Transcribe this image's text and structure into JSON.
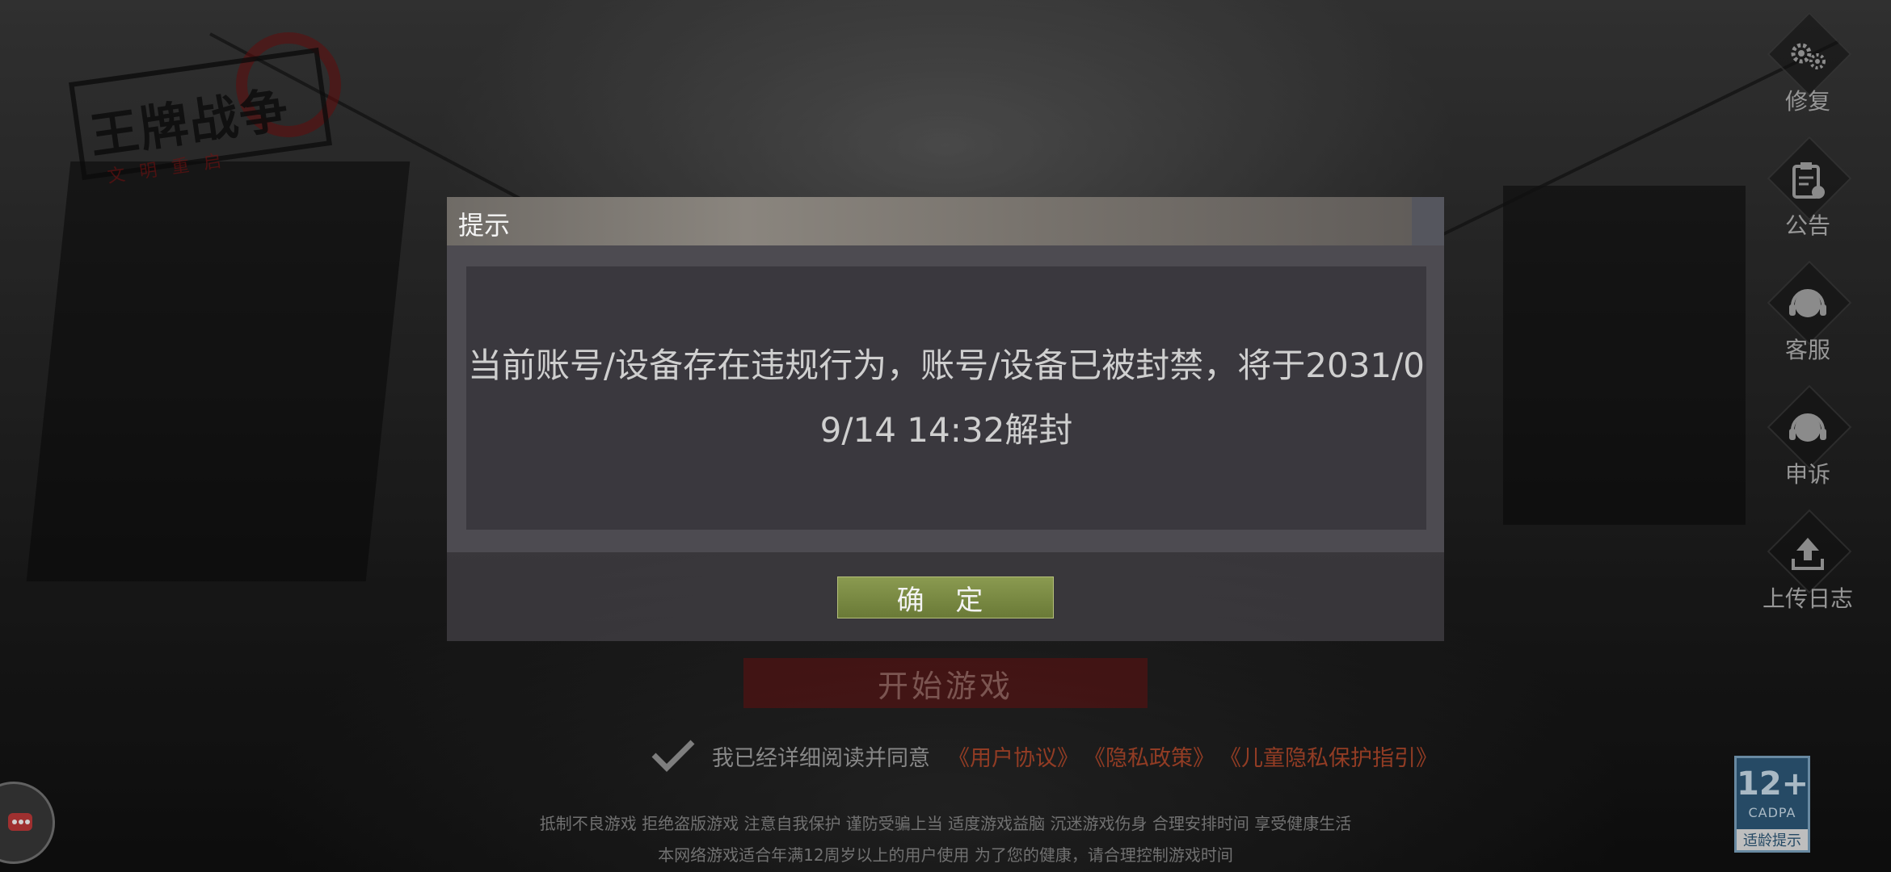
{
  "logo": {
    "title": "王牌战争",
    "subtitle": "文明重启"
  },
  "side_menu": [
    {
      "id": "repair",
      "label": "修复",
      "icon": "gears-icon"
    },
    {
      "id": "announcement",
      "label": "公告",
      "icon": "clipboard-icon"
    },
    {
      "id": "customer_service",
      "label": "客服",
      "icon": "headset-icon"
    },
    {
      "id": "appeal",
      "label": "申诉",
      "icon": "headset-icon"
    },
    {
      "id": "upload_log",
      "label": "上传日志",
      "icon": "upload-icon"
    }
  ],
  "dialog": {
    "title": "提示",
    "message": "当前账号/设备存在违规行为，账号/设备已被封禁，将于2031/09/14 14:32解封",
    "confirm_label": "确 定"
  },
  "start_button": "开始游戏",
  "agreement": {
    "text": "我已经详细阅读并同意",
    "links": [
      "《用户协议》",
      "《隐私政策》",
      "《儿童隐私保护指引》"
    ]
  },
  "health_notice": {
    "line1": "抵制不良游戏 拒绝盗版游戏 注意自我保护 谨防受骗上当 适度游戏益脑 沉迷游戏伤身 合理安排时间 享受健康生活",
    "line2": "本网络游戏适合年满12周岁以上的用户使用    为了您的健康，请合理控制游戏时间"
  },
  "age_badge": {
    "rating": "12+",
    "org": "CADPA",
    "tip": "适龄提示"
  },
  "colors": {
    "accent_red": "#b34a2c",
    "confirm_green": "#7a8a45",
    "badge_blue": "#2f5b7c"
  }
}
